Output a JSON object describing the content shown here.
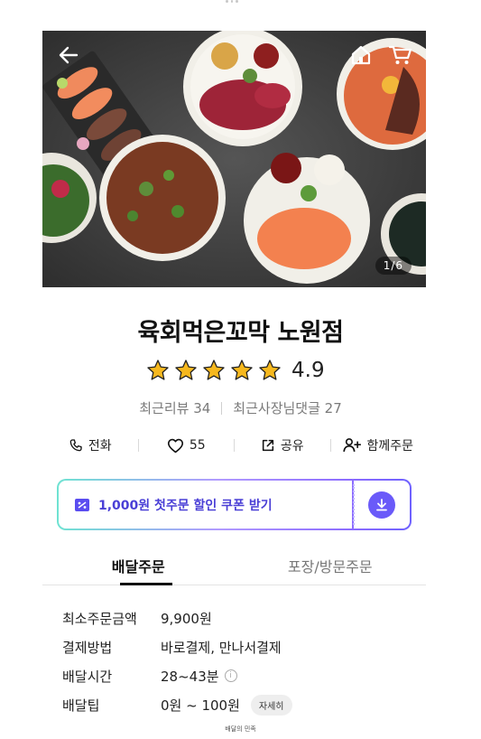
{
  "hero": {
    "page_indicator": "1/6",
    "icons": {
      "back": "arrow-left-icon",
      "home": "home-icon",
      "cart": "cart-icon"
    }
  },
  "store": {
    "name": "육회먹은꼬막 노원점",
    "rating": 4.9,
    "rating_text": "4.9",
    "stars": 5,
    "recent_reviews": "최근리뷰 34",
    "owner_comments": "최근사장님댓글 27"
  },
  "actions": [
    {
      "label": "전화",
      "icon": "phone-icon"
    },
    {
      "label": "55",
      "icon": "heart-icon"
    },
    {
      "label": "공유",
      "icon": "share-icon"
    },
    {
      "label": "함께주문",
      "icon": "add-person-icon"
    }
  ],
  "coupon": {
    "text": "1,000원 첫주문 할인 쿠폰 받기",
    "icon": "coupon-icon",
    "download_icon": "download-icon",
    "colors": {
      "accent": "#6a5af9",
      "text": "#4a3fd6"
    }
  },
  "tabs": [
    {
      "label": "배달주문",
      "active": true
    },
    {
      "label": "포장/방문주문",
      "active": false
    }
  ],
  "info": {
    "min_order_label": "최소주문금액",
    "min_order_value": "9,900원",
    "payment_label": "결제방법",
    "payment_value": "바로결제, 만나서결제",
    "delivery_time_label": "배달시간",
    "delivery_time_value": "28~43분",
    "delivery_tip_label": "배달팁",
    "delivery_tip_value": "0원 ~ 100원",
    "detail_button": "자세히"
  },
  "bottom_note": "배달의 민족"
}
